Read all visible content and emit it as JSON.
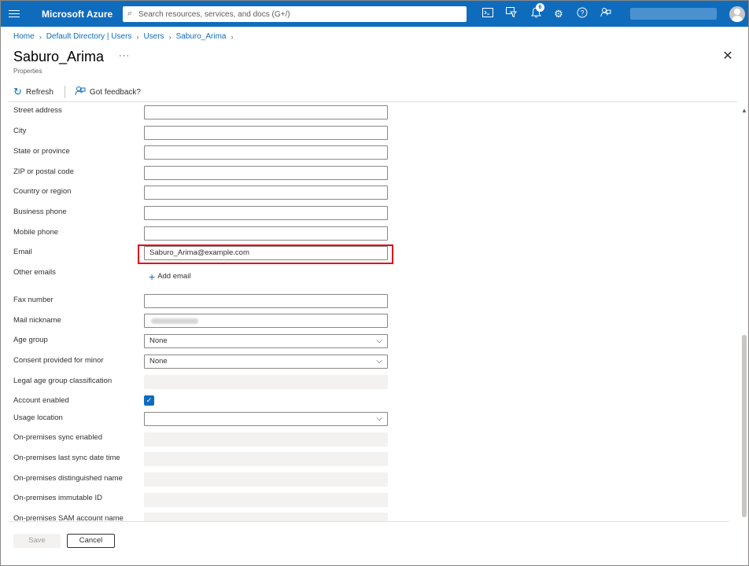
{
  "topbar": {
    "brand": "Microsoft Azure",
    "search_placeholder": "Search resources, services, and docs (G+/)",
    "notification_count": "6",
    "icons": [
      "menu-icon",
      "search-icon",
      "cloud-shell-icon",
      "directory-filter-icon",
      "notifications-icon",
      "settings-icon",
      "help-icon",
      "feedback-icon",
      "avatar"
    ]
  },
  "breadcrumb": [
    "Home",
    "Default Directory | Users",
    "Users",
    "Saburo_Arima"
  ],
  "page": {
    "title": "Saburo_Arima",
    "more": "···",
    "subtitle": "Properties"
  },
  "toolbar": {
    "refresh_label": "Refresh",
    "feedback_label": "Got feedback?"
  },
  "form": {
    "street_address": {
      "label": "Street address",
      "value": ""
    },
    "city": {
      "label": "City",
      "value": ""
    },
    "state": {
      "label": "State or province",
      "value": ""
    },
    "zip": {
      "label": "ZIP or postal code",
      "value": ""
    },
    "country": {
      "label": "Country or region",
      "value": ""
    },
    "business_phone": {
      "label": "Business phone",
      "value": ""
    },
    "mobile_phone": {
      "label": "Mobile phone",
      "value": ""
    },
    "email": {
      "label": "Email",
      "value": "Saburo_Arima@example.com"
    },
    "other_emails": {
      "label": "Other emails",
      "add_label": "Add email"
    },
    "fax": {
      "label": "Fax number",
      "value": ""
    },
    "mail_nickname": {
      "label": "Mail nickname"
    },
    "age_group": {
      "label": "Age group",
      "value": "None"
    },
    "consent_minor": {
      "label": "Consent provided for minor",
      "value": "None"
    },
    "legal_age": {
      "label": "Legal age group classification",
      "value": ""
    },
    "account_enabled": {
      "label": "Account enabled",
      "checked": true
    },
    "usage_location": {
      "label": "Usage location",
      "value": ""
    },
    "onprem_sync": {
      "label": "On-premises sync enabled",
      "value": ""
    },
    "onprem_last_sync": {
      "label": "On-premises last sync date time",
      "value": ""
    },
    "onprem_dn": {
      "label": "On-premises distinguished name",
      "value": ""
    },
    "onprem_immutable": {
      "label": "On-premises immutable ID",
      "value": ""
    },
    "onprem_sam": {
      "label": "On-premises SAM account name",
      "value": ""
    }
  },
  "footer": {
    "save_label": "Save",
    "cancel_label": "Cancel"
  },
  "colors": {
    "brand": "#0f6cbd",
    "highlight": "#e00b1c"
  }
}
